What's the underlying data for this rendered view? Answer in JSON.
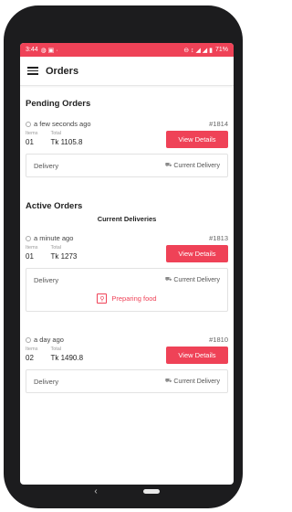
{
  "status_bar": {
    "time": "3:44",
    "indicators": "◍ ▣ ·",
    "right_icons": "⊖ ↕ ◢ ◢ ▮",
    "battery": "71%"
  },
  "app_bar": {
    "title": "Orders",
    "menu_icon": "hamburger-icon"
  },
  "pending": {
    "title": "Pending Orders",
    "orders": [
      {
        "time_ago": "a few seconds ago",
        "id": "#1814",
        "items_label": "Items",
        "items": "01",
        "total_label": "Total",
        "total": "Tk 1105.8",
        "button": "View Details",
        "delivery_label": "Delivery",
        "delivery_status": "Current Delivery"
      }
    ]
  },
  "active": {
    "title": "Active Orders",
    "subtitle": "Current Deliveries",
    "orders": [
      {
        "time_ago": "a minute ago",
        "id": "#1813",
        "items_label": "Items",
        "items": "01",
        "total_label": "Total",
        "total": "Tk 1273",
        "button": "View Details",
        "delivery_label": "Delivery",
        "delivery_status": "Current Delivery",
        "progress_text": "Preparing food"
      },
      {
        "time_ago": "a day ago",
        "id": "#1810",
        "items_label": "Items",
        "items": "02",
        "total_label": "Total",
        "total": "Tk 1490.8",
        "button": "View Details",
        "delivery_label": "Delivery",
        "delivery_status": "Current Delivery"
      }
    ]
  },
  "colors": {
    "accent": "#ef4257",
    "text": "#222222",
    "muted": "#999999"
  },
  "nav": {
    "back_icon": "back-triangle-icon",
    "home_icon": "home-pill-icon"
  }
}
